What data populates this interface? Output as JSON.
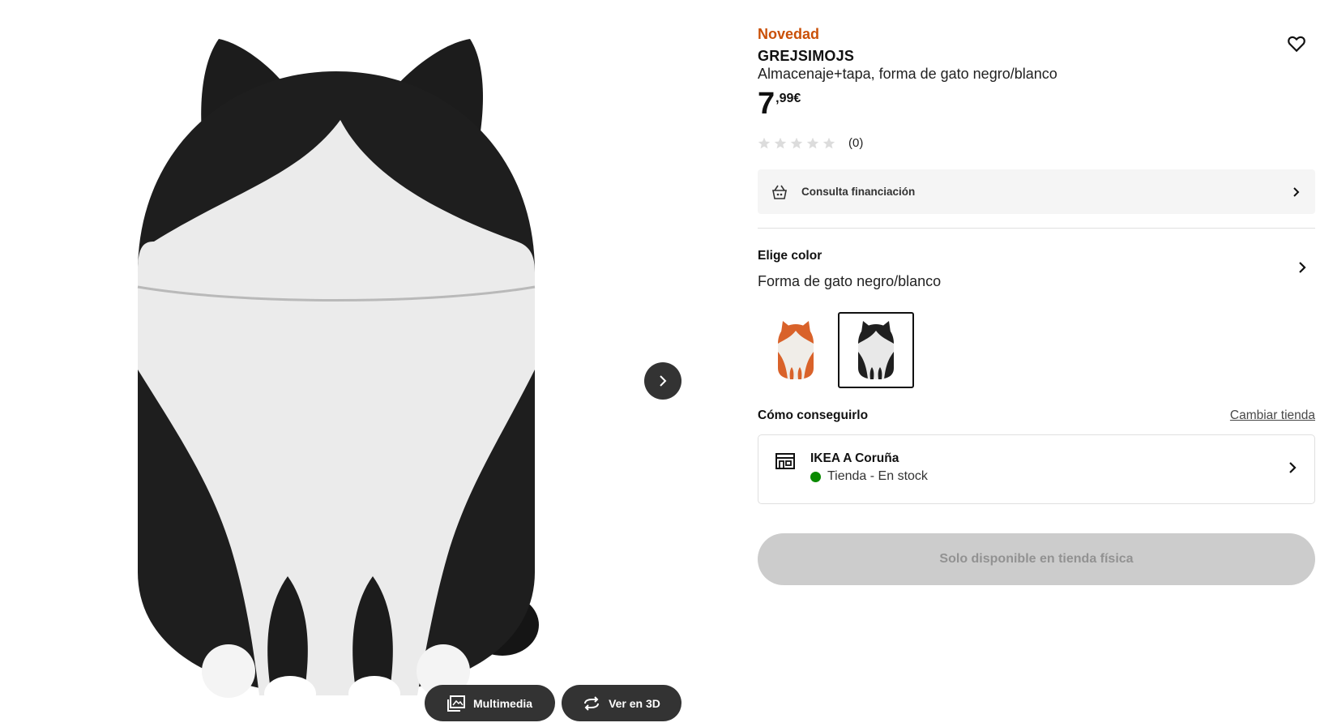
{
  "product": {
    "badge": "Novedad",
    "name": "GREJSIMOJS",
    "description": "Almacenaje+tapa, forma de gato negro/blanco",
    "price_integer": "7",
    "price_decimal": ",99€",
    "rating": {
      "stars_filled": 0,
      "stars_total": 5,
      "count_label": "(0)"
    }
  },
  "gallery": {
    "multimedia_label": "Multimedia",
    "view_3d_label": "Ver en 3D"
  },
  "financing": {
    "label": "Consulta financiación"
  },
  "color": {
    "heading": "Elige color",
    "selected": "Forma de gato negro/blanco",
    "swatches": [
      {
        "name": "orange-cat",
        "selected": false,
        "accent": "#d9622a"
      },
      {
        "name": "black-cat",
        "selected": true,
        "accent": "#1f1f1f"
      }
    ]
  },
  "availability": {
    "heading": "Cómo conseguirlo",
    "change_store": "Cambiar tienda",
    "store_name": "IKEA A Coruña",
    "store_status": "Tienda - En stock"
  },
  "purchase": {
    "button_label": "Solo disponible en tienda física"
  },
  "colors": {
    "novelty": "#ca5008",
    "stock": "#0a8a00",
    "button_disabled": "#cccccc"
  },
  "icons": {
    "favourite": "heart-icon",
    "finance": "payment-icon",
    "store": "store-icon",
    "chevron": "chevron-right-icon",
    "multimedia": "gallery-icon",
    "view_3d": "rotate-3d-icon"
  }
}
